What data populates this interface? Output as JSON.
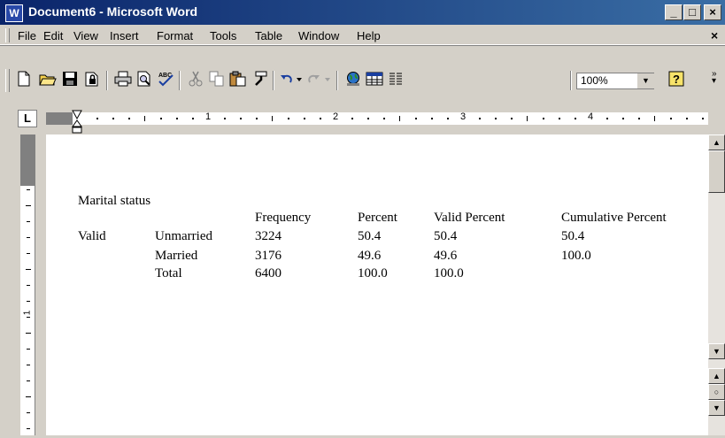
{
  "window": {
    "title": "Document6 - Microsoft Word",
    "app_icon": "W"
  },
  "caption_buttons": {
    "minimize": "_",
    "maximize": "□",
    "close": "×"
  },
  "menu": {
    "items": [
      "File",
      "Edit",
      "View",
      "Insert",
      "Format",
      "Tools",
      "Table",
      "Window",
      "Help"
    ],
    "close": "×"
  },
  "toolbar": {
    "zoom": "100%",
    "icons": [
      "new-document-icon",
      "open-folder-icon",
      "save-icon",
      "permission-icon",
      "print-icon",
      "print-preview-icon",
      "spelling-icon",
      "cut-icon",
      "copy-icon",
      "paste-icon",
      "format-painter-icon",
      "undo-icon",
      "redo-icon",
      "web-icon",
      "insert-table-icon",
      "columns-icon",
      "help-icon"
    ]
  },
  "ruler": {
    "tab_selector": "L",
    "numbers": [
      "1",
      "2",
      "3",
      "4"
    ]
  },
  "document": {
    "title": "Marital status",
    "headers": [
      "Frequency",
      "Percent",
      "Valid Percent",
      "Cumulative Percent"
    ],
    "group_label": "Valid",
    "rows": [
      {
        "label": "Unmarried",
        "frequency": "3224",
        "percent": "50.4",
        "valid_percent": "50.4",
        "cumulative": "50.4"
      },
      {
        "label": "Married",
        "frequency": "3176",
        "percent": "49.6",
        "valid_percent": "49.6",
        "cumulative": "100.0"
      },
      {
        "label": "Total",
        "frequency": "6400",
        "percent": "100.0",
        "valid_percent": "100.0",
        "cumulative": ""
      }
    ]
  }
}
